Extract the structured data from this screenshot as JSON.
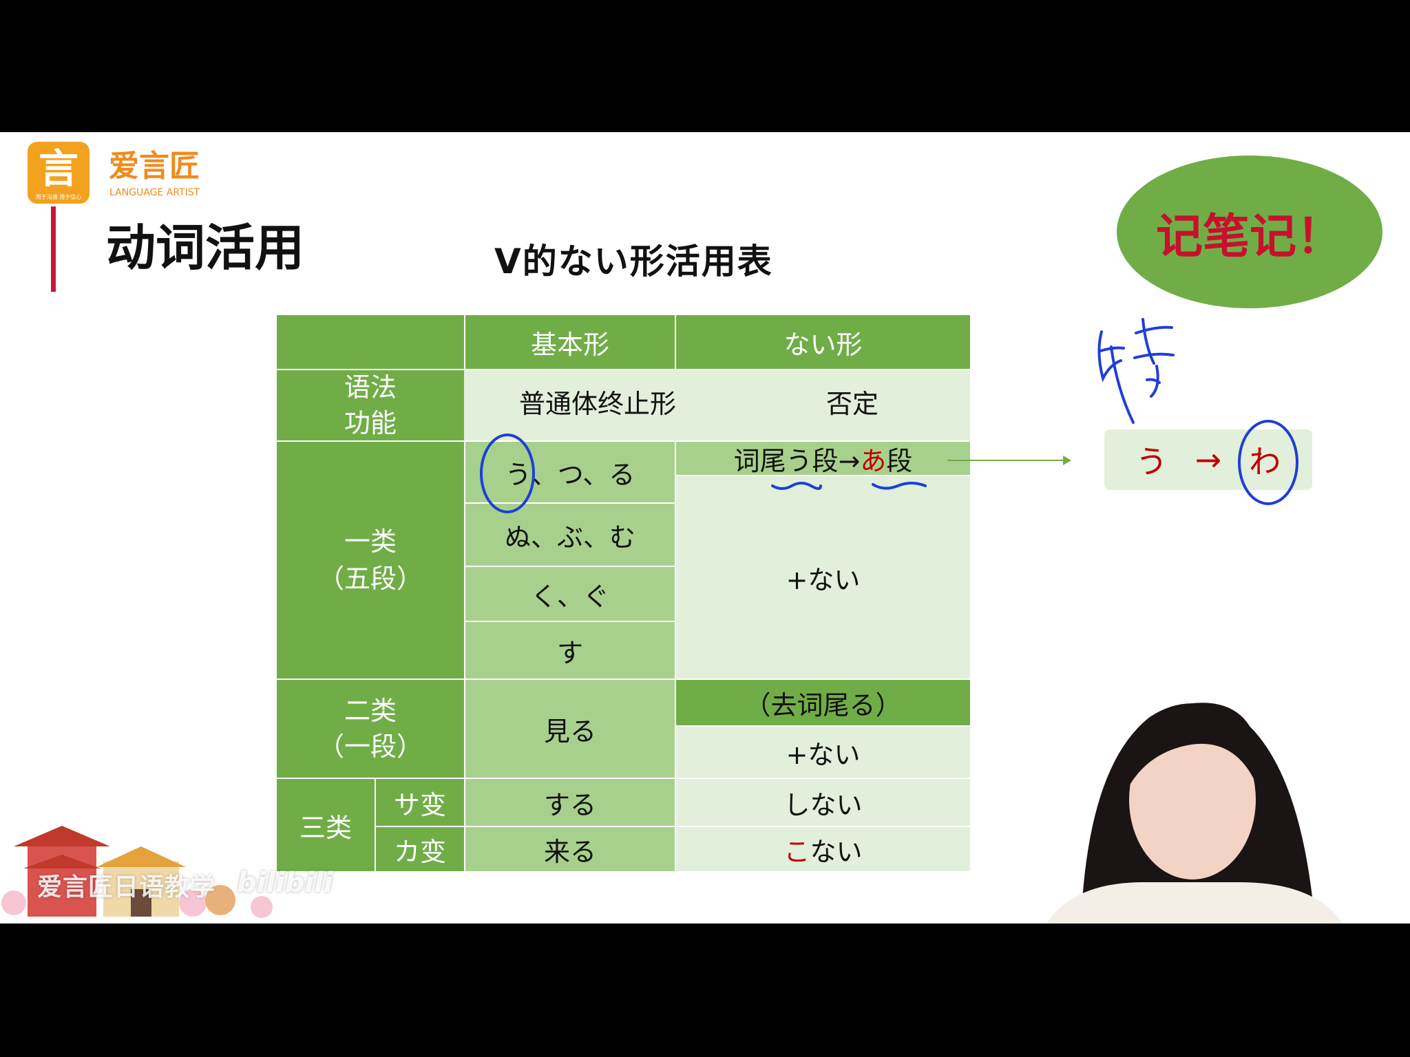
{
  "logo": {
    "glyph": "言",
    "sub_text": "用于沟通 用于信心",
    "brand_cn": "爱言匠",
    "brand_en": "LANGUAGE ARTIST"
  },
  "slide": {
    "title": "动词活用",
    "subtitle": "V的ない形活用表",
    "note_oval": "记笔记！"
  },
  "table": {
    "header": {
      "col_basic": "基本形",
      "col_nai": "ない形"
    },
    "function_row": {
      "label": "语法\n功能",
      "basic": "普通体终止形",
      "nai": "否定"
    },
    "group1": {
      "label": "一类\n（五段）",
      "endings": [
        "う、つ、る",
        "ぬ、ぶ、む",
        "く、ぐ",
        "す"
      ],
      "rule_prefix": "词尾う段→",
      "rule_highlight": "あ",
      "rule_suffix": "段",
      "add": "+ない"
    },
    "group2": {
      "label": "二类\n（一段）",
      "basic": "見る",
      "rule": "（去词尾る）",
      "add": "+ない"
    },
    "group3": {
      "label": "三类",
      "sa": {
        "label": "サ变",
        "basic": "する",
        "nai": "しない"
      },
      "ka": {
        "label": "カ变",
        "basic": "来る",
        "nai_highlight": "こ",
        "nai_rest": "ない"
      }
    }
  },
  "side_note": {
    "from": "う",
    "arrow": "→",
    "to": "わ",
    "handwriting": "特"
  },
  "watermark": {
    "channel": "爱言匠日语教学",
    "platform": "bilibili"
  },
  "colors": {
    "header_green": "#70ad47",
    "mid_green": "#a8d08d",
    "light_green": "#e2efda",
    "accent_red": "#c00000",
    "ink_blue": "#1f3fd6",
    "brand_orange": "#f3a21f"
  }
}
